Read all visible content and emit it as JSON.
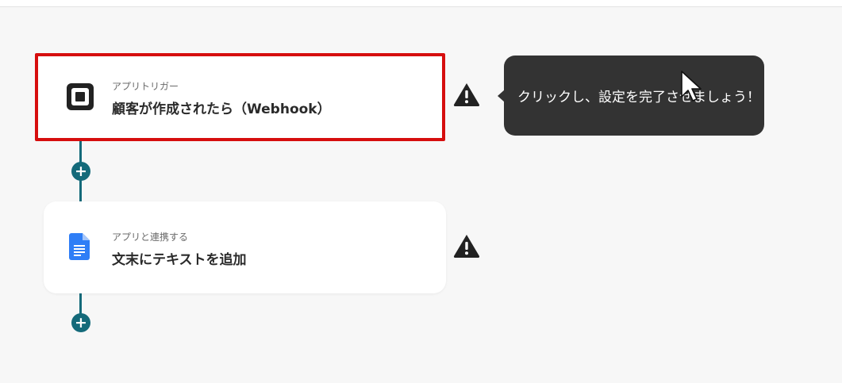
{
  "flow": {
    "trigger": {
      "subtitle": "アプリトリガー",
      "title": "顧客が作成されたら（Webhook）",
      "icon": "square-logo-icon"
    },
    "action": {
      "subtitle": "アプリと連携する",
      "title": "文末にテキストを追加",
      "icon": "google-docs-icon"
    },
    "add_symbol": "+"
  },
  "tooltip": {
    "text": "クリックし、設定を完了させましょう！"
  },
  "colors": {
    "accent": "#146a7a",
    "highlight_border": "#d60e0e",
    "tooltip_bg": "#333333",
    "docs_blue": "#2f7ef6"
  }
}
